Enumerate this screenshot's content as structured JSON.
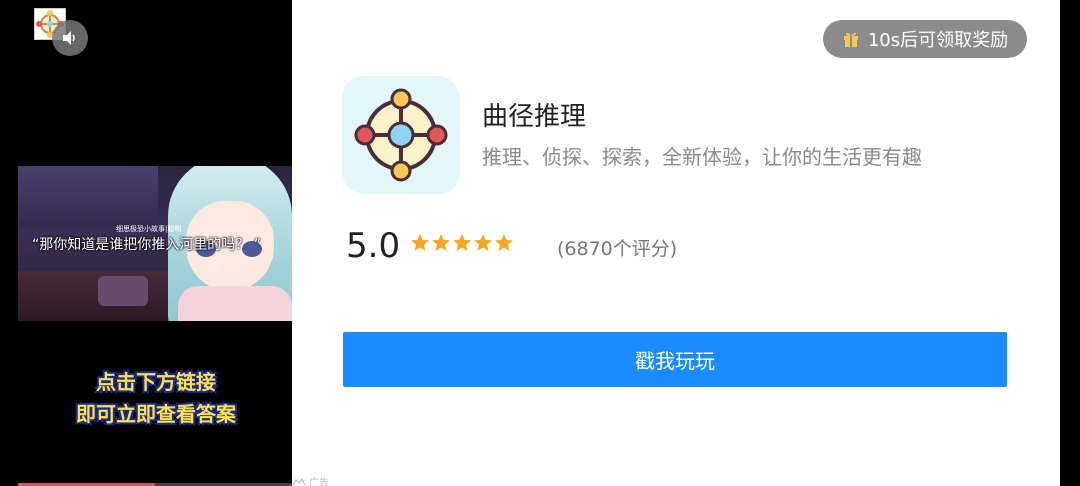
{
  "video": {
    "caption_small": "细思极恐小故事|聪明",
    "caption": "“那你知道是谁把你推入河里的吗？ ”",
    "promo_line1": "点击下方链接",
    "promo_line2": "即可立即查看答案",
    "progress": 0.5,
    "sound_icon": "speaker-icon"
  },
  "reward": {
    "label": "10s后可领取奖励",
    "icon": "gift-icon"
  },
  "app": {
    "name": "曲径推理",
    "description": "推理、侦探、探索，全新体验，让你的生活更有趣",
    "icon": "compass-app-icon"
  },
  "rating": {
    "score": "5.0",
    "stars": 5,
    "count_label": "(6870个评分)"
  },
  "cta": {
    "label": "戳我玩玩"
  },
  "ad": {
    "label": "广告"
  },
  "colors": {
    "cta_blue": "#1a8cff",
    "reward_grey": "#8c8c8c",
    "star_gold": "#f5a623",
    "icon_bg": "#e3f6fb",
    "node_red": "#e05757",
    "node_yellow": "#f7c75a",
    "node_blue": "#8fd3f2",
    "promo_yellow": "#ffe14a"
  }
}
